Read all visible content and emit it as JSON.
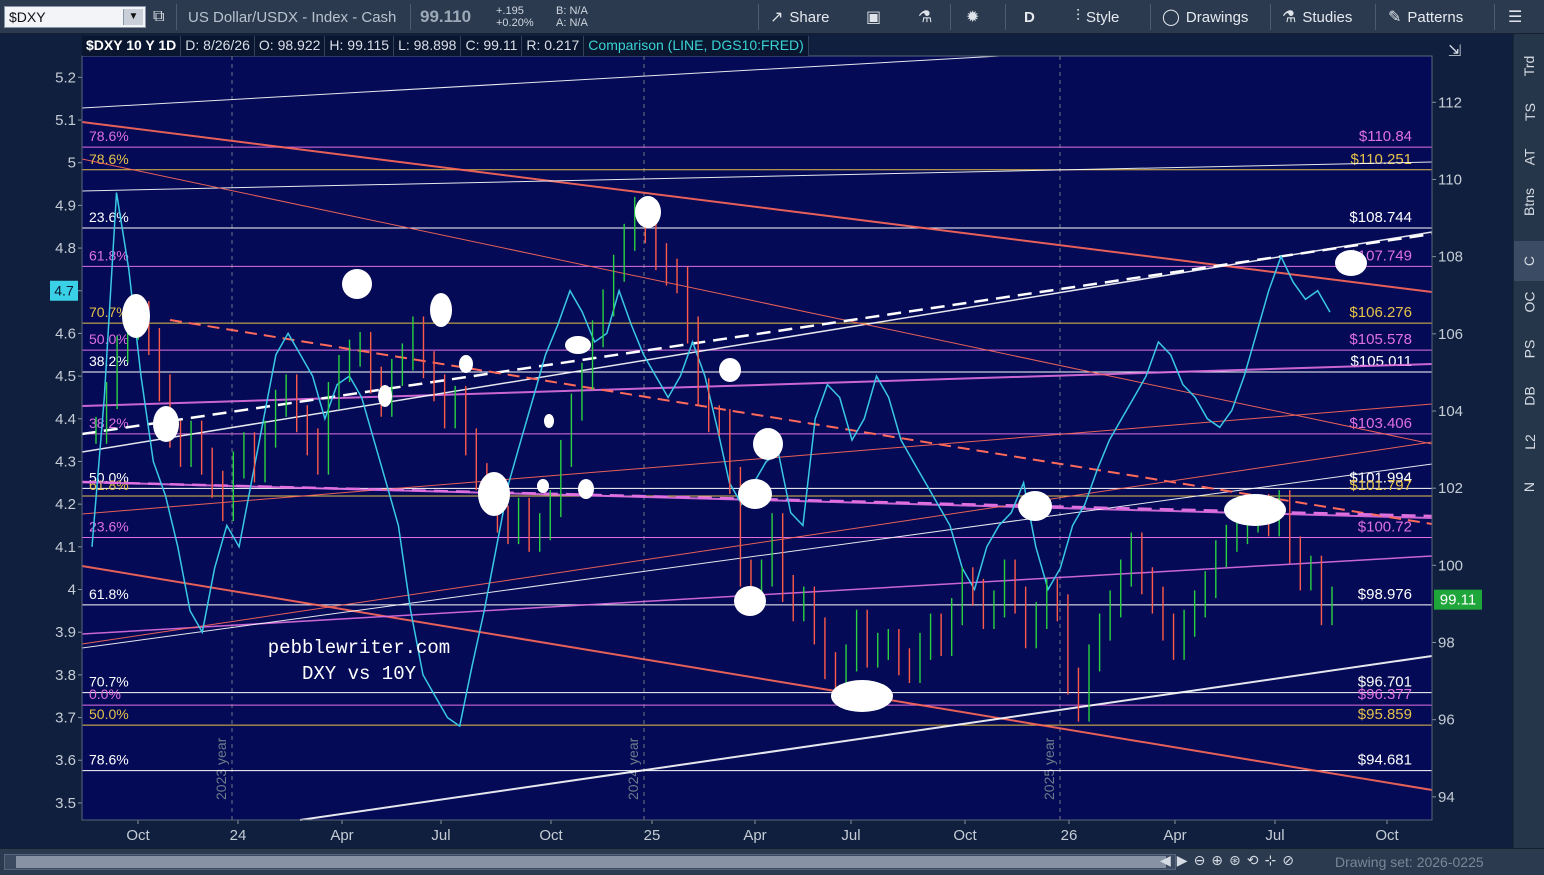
{
  "toolbar": {
    "symbol": "$DXY",
    "description": "US Dollar/USDX - Index - Cash",
    "last_price": "99.110",
    "change_abs": "+.195",
    "change_pct": "+0.20%",
    "bid": "B: N/A",
    "ask": "A: N/A",
    "share_label": "Share",
    "period_label": "D",
    "style_label": "Style",
    "drawings_label": "Drawings",
    "studies_label": "Studies",
    "patterns_label": "Patterns"
  },
  "info_strip": {
    "title": "$DXY 10 Y 1D",
    "date": "D: 8/26/26",
    "open": "O: 98.922",
    "high": "H: 99.115",
    "low": "L: 98.898",
    "close": "C: 99.11",
    "range": "R: 0.217",
    "comparison": "Comparison (LINE, DGS10:FRED)"
  },
  "side_tabs": [
    "Trd",
    "TS",
    "AT",
    "Btns",
    "C",
    "OC",
    "PS",
    "DB",
    "L2",
    "N"
  ],
  "bottom_bar": {
    "drawing_set": "Drawing set: 2026-0225"
  },
  "chart_data": {
    "type": "line",
    "watermark": [
      "pebblewriter.com",
      "DXY vs 10Y"
    ],
    "x_ticks": [
      "Oct",
      "24",
      "Apr",
      "Jul",
      "Oct",
      "25",
      "Apr",
      "Jul",
      "Oct",
      "26",
      "Apr",
      "Jul",
      "Oct"
    ],
    "year_markers": [
      "2023 year",
      "2024 year",
      "2025 year"
    ],
    "left_axis": {
      "label": "10Y yield",
      "ticks": [
        "5.2",
        "5.1",
        "5",
        "4.9",
        "4.8",
        "4.7",
        "4.6",
        "4.5",
        "4.4",
        "4.3",
        "4.2",
        "4.1",
        "4",
        "3.9",
        "3.8",
        "3.7",
        "3.6",
        "3.5"
      ],
      "range": [
        3.46,
        5.25
      ],
      "current": "4.7"
    },
    "right_axis": {
      "label": "DXY",
      "ticks": [
        "112",
        "110",
        "108",
        "106",
        "104",
        "102",
        "100",
        "98",
        "96",
        "94"
      ],
      "range": [
        93.4,
        113.2
      ],
      "current": "99.11",
      "current_color": "#1fa63a"
    },
    "fib_left_labels": [
      {
        "text": "78.6%",
        "color": "#e070e0"
      },
      {
        "text": "78.6%",
        "color": "#e6c24a"
      },
      {
        "text": "23.6%",
        "color": "#ffffff"
      },
      {
        "text": "61.8%",
        "color": "#e070e0"
      },
      {
        "text": "70.7%",
        "color": "#e6c24a"
      },
      {
        "text": "50.0%",
        "color": "#e070e0"
      },
      {
        "text": "38.2%",
        "color": "#ffffff"
      },
      {
        "text": "38.2%",
        "color": "#e070e0"
      },
      {
        "text": "50.0%",
        "color": "#ffffff"
      },
      {
        "text": "61.8%",
        "color": "#e6c24a"
      },
      {
        "text": "23.6%",
        "color": "#e070e0"
      },
      {
        "text": "61.8%",
        "color": "#ffffff"
      },
      {
        "text": "70.7%",
        "color": "#ffffff"
      },
      {
        "text": "0.0%",
        "color": "#e070e0"
      },
      {
        "text": "50.0%",
        "color": "#e6c24a"
      },
      {
        "text": "78.6%",
        "color": "#ffffff"
      }
    ],
    "price_levels": [
      {
        "text": "$110.84",
        "value": 110.84,
        "color": "#e070e0"
      },
      {
        "text": "$110.251",
        "value": 110.251,
        "color": "#e6c24a"
      },
      {
        "text": "$108.744",
        "value": 108.744,
        "color": "#ffffff"
      },
      {
        "text": "$107.749",
        "value": 107.749,
        "color": "#e070e0"
      },
      {
        "text": "$106.276",
        "value": 106.276,
        "color": "#e6c24a"
      },
      {
        "text": "$105.578",
        "value": 105.578,
        "color": "#e070e0"
      },
      {
        "text": "$105.011",
        "value": 105.011,
        "color": "#ffffff"
      },
      {
        "text": "$103.406",
        "value": 103.406,
        "color": "#e070e0"
      },
      {
        "text": "$101.994",
        "value": 101.994,
        "color": "#ffffff"
      },
      {
        "text": "$101.797",
        "value": 101.797,
        "color": "#e6c24a"
      },
      {
        "text": "$100.72",
        "value": 100.72,
        "color": "#e070e0"
      },
      {
        "text": "$98.976",
        "value": 98.976,
        "color": "#ffffff"
      },
      {
        "text": "$96.701",
        "value": 96.701,
        "color": "#ffffff"
      },
      {
        "text": "$96.377",
        "value": 96.377,
        "color": "#e070e0"
      },
      {
        "text": "$95.859",
        "value": 95.859,
        "color": "#e6c24a"
      },
      {
        "text": "$94.681",
        "value": 94.681,
        "color": "#ffffff"
      }
    ],
    "series": [
      {
        "name": "$DXY",
        "color_up": "#2ad142",
        "color_down": "#ff5a4a",
        "axis": "right",
        "values": [
          103.5,
          104.4,
          105.6,
          106.2,
          106.5,
          105.8,
          104.6,
          103.4,
          102.9,
          103.4,
          102.7,
          102.1,
          101.5,
          102.6,
          103.1,
          102.5,
          103.4,
          104.2,
          104.6,
          103.8,
          103.2,
          102.7,
          104.4,
          105.1,
          105.5,
          105.7,
          104.8,
          104.2,
          105.0,
          105.4,
          106.1,
          105.2,
          104.6,
          103.9,
          104.3,
          103.2,
          102.3,
          101.8,
          101.2,
          100.9,
          101.4,
          100.7,
          101.0,
          101.6,
          102.9,
          104.1,
          104.9,
          106.0,
          106.8,
          107.7,
          108.5,
          109.2,
          108.7,
          108.0,
          107.6,
          107.4,
          106.1,
          104.5,
          103.8,
          103.7,
          102.2,
          99.8,
          99.3,
          99.8,
          101.0,
          99.4,
          98.9,
          99.1,
          98.3,
          97.4,
          96.9,
          97.6,
          98.5,
          97.7,
          97.9,
          98.0,
          97.5,
          97.3,
          97.9,
          98.4,
          98.0,
          98.8,
          99.6,
          99.3,
          98.7,
          99.0,
          99.8,
          99.1,
          98.2,
          98.7,
          99.3,
          98.9,
          97.0,
          96.3,
          97.6,
          98.4,
          99.0,
          99.8,
          100.5,
          99.6,
          99.1,
          98.4,
          97.9,
          98.5,
          99.0,
          99.5,
          100.3,
          100.7,
          100.9,
          101.2,
          101.5,
          101.1,
          101.6,
          100.4,
          99.7,
          99.9,
          98.8,
          99.1
        ]
      },
      {
        "name": "10Y",
        "color": "#39c8e6",
        "axis": "left",
        "values": [
          4.1,
          4.45,
          4.93,
          4.75,
          4.5,
          4.3,
          4.22,
          4.1,
          3.95,
          3.9,
          4.05,
          4.15,
          4.1,
          4.25,
          4.4,
          4.55,
          4.6,
          4.55,
          4.5,
          4.4,
          4.48,
          4.5,
          4.45,
          4.35,
          4.25,
          4.15,
          3.95,
          3.8,
          3.75,
          3.7,
          3.68,
          3.82,
          3.95,
          4.1,
          4.25,
          4.35,
          4.45,
          4.55,
          4.62,
          4.7,
          4.65,
          4.58,
          4.6,
          4.7,
          4.62,
          4.55,
          4.5,
          4.45,
          4.5,
          4.58,
          4.5,
          4.38,
          4.25,
          4.2,
          4.25,
          4.3,
          4.32,
          4.18,
          4.15,
          4.4,
          4.48,
          4.45,
          4.35,
          4.4,
          4.5,
          4.45,
          4.35,
          4.3,
          4.25,
          4.2,
          4.15,
          4.05,
          4.0,
          4.1,
          4.15,
          4.18,
          4.25,
          4.1,
          4.0,
          4.05,
          4.15,
          4.2,
          4.28,
          4.35,
          4.4,
          4.45,
          4.5,
          4.58,
          4.55,
          4.48,
          4.45,
          4.4,
          4.38,
          4.42,
          4.5,
          4.6,
          4.7,
          4.78,
          4.72,
          4.68,
          4.7,
          4.65
        ]
      }
    ]
  }
}
